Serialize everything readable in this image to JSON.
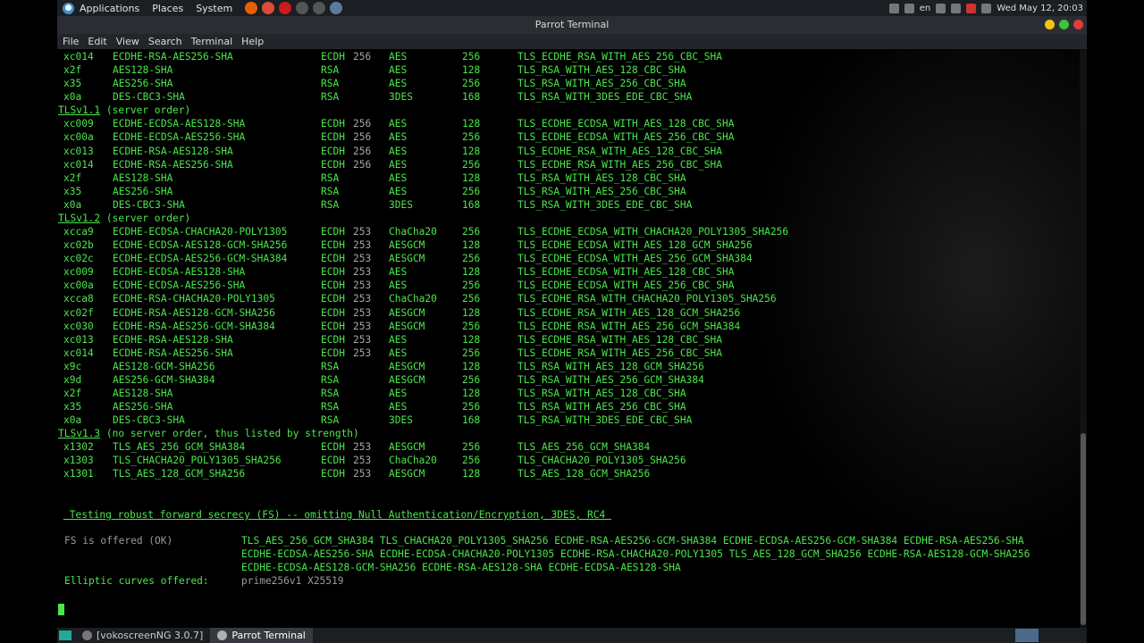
{
  "panel": {
    "menus": [
      "Applications",
      "Places",
      "System"
    ],
    "launchers": [
      {
        "name": "firefox-icon",
        "color": "#e66000"
      },
      {
        "name": "chrome-icon",
        "color": "#dd4b39"
      },
      {
        "name": "opera-icon",
        "color": "#cc1b1b"
      },
      {
        "name": "terminal-launcher-icon",
        "color": "#555555"
      },
      {
        "name": "settings-launcher-icon",
        "color": "#555555"
      },
      {
        "name": "screenshot-launcher-icon",
        "color": "#5a7aa0"
      }
    ],
    "lang": "en",
    "clock": "Wed May 12, 20:03"
  },
  "window": {
    "title": "Parrot Terminal"
  },
  "menubar": [
    "File",
    "Edit",
    "View",
    "Search",
    "Terminal",
    "Help"
  ],
  "terminal": {
    "cipher_rows": [
      {
        "hex": "xc014",
        "name": "ECDHE-RSA-AES256-SHA",
        "kx": "ECDH",
        "bits": "256",
        "enc": "AES",
        "size": "256",
        "iana": "TLS_ECDHE_RSA_WITH_AES_256_CBC_SHA"
      },
      {
        "hex": "x2f",
        "name": "AES128-SHA",
        "kx": "RSA",
        "bits": "",
        "enc": "AES",
        "size": "128",
        "iana": "TLS_RSA_WITH_AES_128_CBC_SHA"
      },
      {
        "hex": "x35",
        "name": "AES256-SHA",
        "kx": "RSA",
        "bits": "",
        "enc": "AES",
        "size": "256",
        "iana": "TLS_RSA_WITH_AES_256_CBC_SHA"
      },
      {
        "hex": "x0a",
        "name": "DES-CBC3-SHA",
        "kx": "RSA",
        "bits": "",
        "enc": "3DES",
        "size": "168",
        "iana": "TLS_RSA_WITH_3DES_EDE_CBC_SHA"
      },
      {
        "section": "TLSv1.1",
        "note": " (server order)"
      },
      {
        "hex": "xc009",
        "name": "ECDHE-ECDSA-AES128-SHA",
        "kx": "ECDH",
        "bits": "256",
        "enc": "AES",
        "size": "128",
        "iana": "TLS_ECDHE_ECDSA_WITH_AES_128_CBC_SHA"
      },
      {
        "hex": "xc00a",
        "name": "ECDHE-ECDSA-AES256-SHA",
        "kx": "ECDH",
        "bits": "256",
        "enc": "AES",
        "size": "256",
        "iana": "TLS_ECDHE_ECDSA_WITH_AES_256_CBC_SHA"
      },
      {
        "hex": "xc013",
        "name": "ECDHE-RSA-AES128-SHA",
        "kx": "ECDH",
        "bits": "256",
        "enc": "AES",
        "size": "128",
        "iana": "TLS_ECDHE_RSA_WITH_AES_128_CBC_SHA"
      },
      {
        "hex": "xc014",
        "name": "ECDHE-RSA-AES256-SHA",
        "kx": "ECDH",
        "bits": "256",
        "enc": "AES",
        "size": "256",
        "iana": "TLS_ECDHE_RSA_WITH_AES_256_CBC_SHA"
      },
      {
        "hex": "x2f",
        "name": "AES128-SHA",
        "kx": "RSA",
        "bits": "",
        "enc": "AES",
        "size": "128",
        "iana": "TLS_RSA_WITH_AES_128_CBC_SHA"
      },
      {
        "hex": "x35",
        "name": "AES256-SHA",
        "kx": "RSA",
        "bits": "",
        "enc": "AES",
        "size": "256",
        "iana": "TLS_RSA_WITH_AES_256_CBC_SHA"
      },
      {
        "hex": "x0a",
        "name": "DES-CBC3-SHA",
        "kx": "RSA",
        "bits": "",
        "enc": "3DES",
        "size": "168",
        "iana": "TLS_RSA_WITH_3DES_EDE_CBC_SHA"
      },
      {
        "section": "TLSv1.2",
        "note": " (server order)"
      },
      {
        "hex": "xcca9",
        "name": "ECDHE-ECDSA-CHACHA20-POLY1305",
        "kx": "ECDH",
        "bits": "253",
        "enc": "ChaCha20",
        "size": "256",
        "iana": "TLS_ECDHE_ECDSA_WITH_CHACHA20_POLY1305_SHA256"
      },
      {
        "hex": "xc02b",
        "name": "ECDHE-ECDSA-AES128-GCM-SHA256",
        "kx": "ECDH",
        "bits": "253",
        "enc": "AESGCM",
        "size": "128",
        "iana": "TLS_ECDHE_ECDSA_WITH_AES_128_GCM_SHA256"
      },
      {
        "hex": "xc02c",
        "name": "ECDHE-ECDSA-AES256-GCM-SHA384",
        "kx": "ECDH",
        "bits": "253",
        "enc": "AESGCM",
        "size": "256",
        "iana": "TLS_ECDHE_ECDSA_WITH_AES_256_GCM_SHA384"
      },
      {
        "hex": "xc009",
        "name": "ECDHE-ECDSA-AES128-SHA",
        "kx": "ECDH",
        "bits": "253",
        "enc": "AES",
        "size": "128",
        "iana": "TLS_ECDHE_ECDSA_WITH_AES_128_CBC_SHA"
      },
      {
        "hex": "xc00a",
        "name": "ECDHE-ECDSA-AES256-SHA",
        "kx": "ECDH",
        "bits": "253",
        "enc": "AES",
        "size": "256",
        "iana": "TLS_ECDHE_ECDSA_WITH_AES_256_CBC_SHA"
      },
      {
        "hex": "xcca8",
        "name": "ECDHE-RSA-CHACHA20-POLY1305",
        "kx": "ECDH",
        "bits": "253",
        "enc": "ChaCha20",
        "size": "256",
        "iana": "TLS_ECDHE_RSA_WITH_CHACHA20_POLY1305_SHA256"
      },
      {
        "hex": "xc02f",
        "name": "ECDHE-RSA-AES128-GCM-SHA256",
        "kx": "ECDH",
        "bits": "253",
        "enc": "AESGCM",
        "size": "128",
        "iana": "TLS_ECDHE_RSA_WITH_AES_128_GCM_SHA256"
      },
      {
        "hex": "xc030",
        "name": "ECDHE-RSA-AES256-GCM-SHA384",
        "kx": "ECDH",
        "bits": "253",
        "enc": "AESGCM",
        "size": "256",
        "iana": "TLS_ECDHE_RSA_WITH_AES_256_GCM_SHA384"
      },
      {
        "hex": "xc013",
        "name": "ECDHE-RSA-AES128-SHA",
        "kx": "ECDH",
        "bits": "253",
        "enc": "AES",
        "size": "128",
        "iana": "TLS_ECDHE_RSA_WITH_AES_128_CBC_SHA"
      },
      {
        "hex": "xc014",
        "name": "ECDHE-RSA-AES256-SHA",
        "kx": "ECDH",
        "bits": "253",
        "enc": "AES",
        "size": "256",
        "iana": "TLS_ECDHE_RSA_WITH_AES_256_CBC_SHA"
      },
      {
        "hex": "x9c",
        "name": "AES128-GCM-SHA256",
        "kx": "RSA",
        "bits": "",
        "enc": "AESGCM",
        "size": "128",
        "iana": "TLS_RSA_WITH_AES_128_GCM_SHA256"
      },
      {
        "hex": "x9d",
        "name": "AES256-GCM-SHA384",
        "kx": "RSA",
        "bits": "",
        "enc": "AESGCM",
        "size": "256",
        "iana": "TLS_RSA_WITH_AES_256_GCM_SHA384"
      },
      {
        "hex": "x2f",
        "name": "AES128-SHA",
        "kx": "RSA",
        "bits": "",
        "enc": "AES",
        "size": "128",
        "iana": "TLS_RSA_WITH_AES_128_CBC_SHA"
      },
      {
        "hex": "x35",
        "name": "AES256-SHA",
        "kx": "RSA",
        "bits": "",
        "enc": "AES",
        "size": "256",
        "iana": "TLS_RSA_WITH_AES_256_CBC_SHA"
      },
      {
        "hex": "x0a",
        "name": "DES-CBC3-SHA",
        "kx": "RSA",
        "bits": "",
        "enc": "3DES",
        "size": "168",
        "iana": "TLS_RSA_WITH_3DES_EDE_CBC_SHA"
      },
      {
        "section": "TLSv1.3",
        "note": " (no server order, thus listed by strength)"
      },
      {
        "hex": "x1302",
        "name": "TLS_AES_256_GCM_SHA384",
        "kx": "ECDH",
        "bits": "253",
        "enc": "AESGCM",
        "size": "256",
        "iana": "TLS_AES_256_GCM_SHA384"
      },
      {
        "hex": "x1303",
        "name": "TLS_CHACHA20_POLY1305_SHA256",
        "kx": "ECDH",
        "bits": "253",
        "enc": "ChaCha20",
        "size": "256",
        "iana": "TLS_CHACHA20_POLY1305_SHA256"
      },
      {
        "hex": "x1301",
        "name": "TLS_AES_128_GCM_SHA256",
        "kx": "ECDH",
        "bits": "253",
        "enc": "AESGCM",
        "size": "128",
        "iana": "TLS_AES_128_GCM_SHA256"
      }
    ],
    "fs_heading": " Testing robust forward secrecy (FS) -- omitting Null Authentication/Encryption, 3DES, RC4 ",
    "fs_label": "FS is offered (OK)",
    "fs_lines": [
      "TLS_AES_256_GCM_SHA384 TLS_CHACHA20_POLY1305_SHA256 ECDHE-RSA-AES256-GCM-SHA384 ECDHE-ECDSA-AES256-GCM-SHA384 ECDHE-RSA-AES256-SHA",
      "ECDHE-ECDSA-AES256-SHA ECDHE-ECDSA-CHACHA20-POLY1305 ECDHE-RSA-CHACHA20-POLY1305 TLS_AES_128_GCM_SHA256 ECDHE-RSA-AES128-GCM-SHA256",
      "ECDHE-ECDSA-AES128-GCM-SHA256 ECDHE-RSA-AES128-SHA ECDHE-ECDSA-AES128-SHA"
    ],
    "curves_label": "Elliptic curves offered:",
    "curves_value": "prime256v1 X25519"
  },
  "taskbar": {
    "tasks": [
      {
        "label": "[vokoscreenNG 3.0.7]",
        "active": false
      },
      {
        "label": "Parrot Terminal",
        "active": true
      }
    ]
  }
}
